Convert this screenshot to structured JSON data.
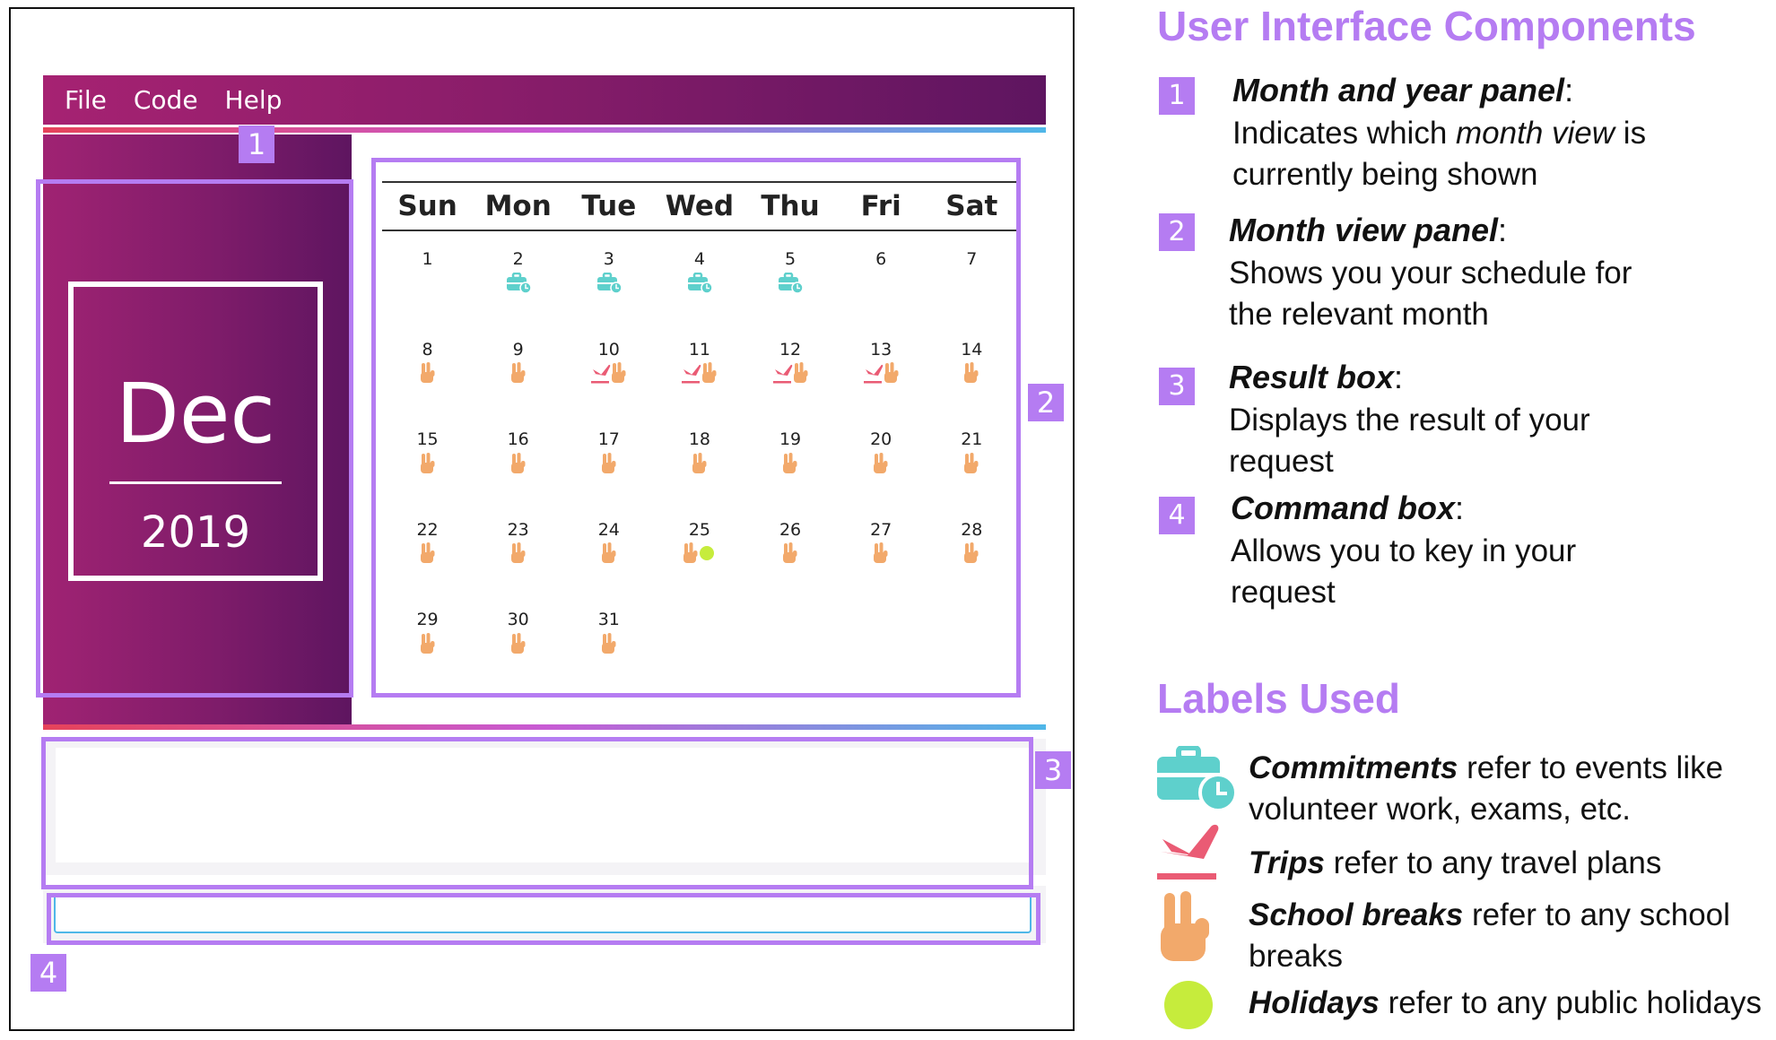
{
  "menu": {
    "items": [
      "File",
      "Code",
      "Help"
    ]
  },
  "month_panel": {
    "month": "Dec",
    "year": "2019"
  },
  "calendar": {
    "weekdays": [
      "Sun",
      "Mon",
      "Tue",
      "Wed",
      "Thu",
      "Fri",
      "Sat"
    ],
    "days": [
      {
        "n": "1",
        "marks": []
      },
      {
        "n": "2",
        "marks": [
          "commitment"
        ]
      },
      {
        "n": "3",
        "marks": [
          "commitment"
        ]
      },
      {
        "n": "4",
        "marks": [
          "commitment"
        ]
      },
      {
        "n": "5",
        "marks": [
          "commitment"
        ]
      },
      {
        "n": "6",
        "marks": []
      },
      {
        "n": "7",
        "marks": []
      },
      {
        "n": "8",
        "marks": [
          "school-break"
        ]
      },
      {
        "n": "9",
        "marks": [
          "school-break"
        ]
      },
      {
        "n": "10",
        "marks": [
          "trip",
          "school-break"
        ]
      },
      {
        "n": "11",
        "marks": [
          "trip",
          "school-break"
        ]
      },
      {
        "n": "12",
        "marks": [
          "trip",
          "school-break"
        ]
      },
      {
        "n": "13",
        "marks": [
          "trip",
          "school-break"
        ]
      },
      {
        "n": "14",
        "marks": [
          "school-break"
        ]
      },
      {
        "n": "15",
        "marks": [
          "school-break"
        ]
      },
      {
        "n": "16",
        "marks": [
          "school-break"
        ]
      },
      {
        "n": "17",
        "marks": [
          "school-break"
        ]
      },
      {
        "n": "18",
        "marks": [
          "school-break"
        ]
      },
      {
        "n": "19",
        "marks": [
          "school-break"
        ]
      },
      {
        "n": "20",
        "marks": [
          "school-break"
        ]
      },
      {
        "n": "21",
        "marks": [
          "school-break"
        ]
      },
      {
        "n": "22",
        "marks": [
          "school-break"
        ]
      },
      {
        "n": "23",
        "marks": [
          "school-break"
        ]
      },
      {
        "n": "24",
        "marks": [
          "school-break"
        ]
      },
      {
        "n": "25",
        "marks": [
          "school-break",
          "holiday"
        ]
      },
      {
        "n": "26",
        "marks": [
          "school-break"
        ]
      },
      {
        "n": "27",
        "marks": [
          "school-break"
        ]
      },
      {
        "n": "28",
        "marks": [
          "school-break"
        ]
      },
      {
        "n": "29",
        "marks": [
          "school-break"
        ]
      },
      {
        "n": "30",
        "marks": [
          "school-break"
        ]
      },
      {
        "n": "31",
        "marks": [
          "school-break"
        ]
      }
    ]
  },
  "result_box": {
    "text": ""
  },
  "command_box": {
    "value": "",
    "placeholder": ""
  },
  "callout_numbers": [
    "1",
    "2",
    "3",
    "4"
  ],
  "legend": {
    "components_title": "User Interface Components",
    "components": [
      {
        "num": "1",
        "title": "Month and year panel",
        "colon": ":",
        "desc_pre": "Indicates which ",
        "desc_em": "month view",
        "desc_post": " is currently being shown"
      },
      {
        "num": "2",
        "title": "Month view panel",
        "colon": ":",
        "desc": "Shows you your schedule for the relevant month"
      },
      {
        "num": "3",
        "title": "Result box",
        "colon": ":",
        "desc": "Displays the result of your request"
      },
      {
        "num": "4",
        "title": "Command box",
        "colon": ":",
        "desc": "Allows you to key in your request"
      }
    ],
    "labels_title": "Labels Used",
    "labels": [
      {
        "icon": "commitment-icon",
        "term": "Commitments",
        "text": " refer to events like volunteer work, exams, etc."
      },
      {
        "icon": "trip-icon",
        "term": "Trips",
        "text": " refer to any travel plans"
      },
      {
        "icon": "school-break-icon",
        "term": "School breaks",
        "text": " refer to any school breaks"
      },
      {
        "icon": "holiday-icon",
        "term": "Holidays",
        "text": " refer to any public holidays"
      }
    ]
  },
  "colors": {
    "accent": "#b57cf2",
    "panel_start": "#a62272",
    "panel_end": "#5e1560",
    "commitment": "#5ed0cc",
    "trip": "#ea5b74",
    "school_break": "#f2a96b",
    "holiday": "#c6ec3c"
  }
}
